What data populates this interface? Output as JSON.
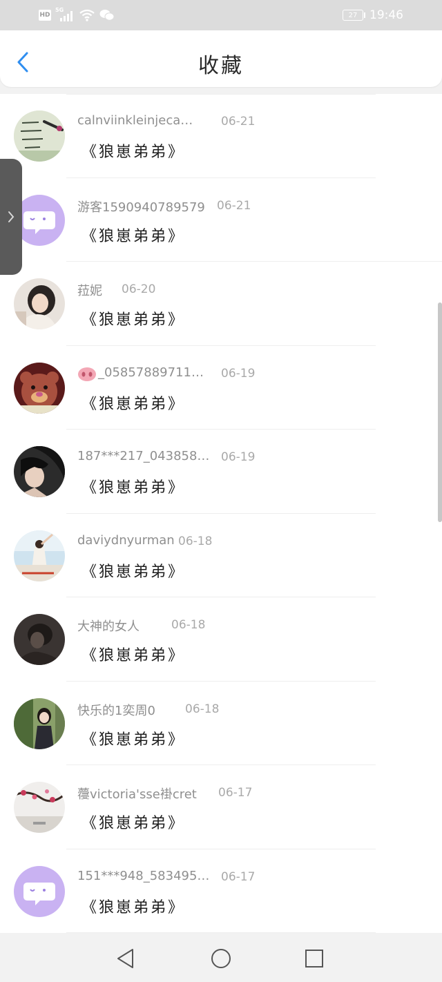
{
  "status_bar": {
    "hd": "HD",
    "network": "5G",
    "battery_level": "27",
    "time": "19:46",
    "icons": [
      "hd-icon",
      "signal-icon",
      "wifi-icon",
      "wechat-icon",
      "battery-icon"
    ]
  },
  "header": {
    "back_icon": "chevron-left-icon",
    "title": "收藏"
  },
  "favorites": [
    {
      "username": "calnviinkleinjeca…",
      "date": "06-21",
      "content": "《狼崽弟弟》",
      "avatar": "handwriting-photo"
    },
    {
      "username": "游客1590940789579",
      "date": "06-21",
      "content": "《狼崽弟弟》",
      "avatar": "default-chat-bubble"
    },
    {
      "username": "菈妮",
      "date": "06-20",
      "content": "《狼崽弟弟》",
      "avatar": "girl-photo"
    },
    {
      "username": "_05857889711…",
      "date": "06-19",
      "content": "《狼崽弟弟》",
      "avatar": "teddy-bear-photo",
      "prefix_icon": "pig-nose-icon"
    },
    {
      "username": "187***217_043858…",
      "date": "06-19",
      "content": "《狼崽弟弟》",
      "avatar": "girl-dark-photo"
    },
    {
      "username": "daviydnyurman",
      "date": "06-18",
      "content": "《狼崽弟弟》",
      "avatar": "sky-girl-photo"
    },
    {
      "username": "大神的女人",
      "date": "06-18",
      "content": "《狼崽弟弟》",
      "avatar": "dark-photo"
    },
    {
      "username": "快乐的1奕周0",
      "date": "06-18",
      "content": "《狼崽弟弟》",
      "avatar": "green-girl-photo"
    },
    {
      "username": "蘉victoria'sse褂cret",
      "date": "06-17",
      "content": "《狼崽弟弟》",
      "avatar": "plum-blossom-photo"
    },
    {
      "username": "151***948_583495…",
      "date": "06-17",
      "content": "《狼崽弟弟》",
      "avatar": "default-chat-bubble"
    }
  ],
  "colors": {
    "accent": "#2f8ef0",
    "default_avatar": "#c9b2f2",
    "text_primary": "#1f1f1f",
    "text_secondary": "#8f8f8f"
  },
  "bottom_nav": [
    "back-triangle-icon",
    "home-circle-icon",
    "recents-square-icon"
  ]
}
